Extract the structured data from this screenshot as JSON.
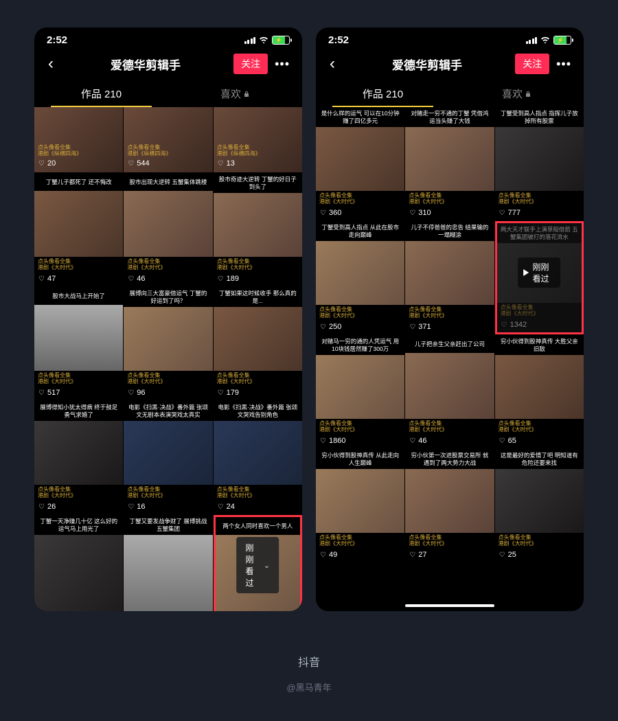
{
  "status": {
    "time": "2:52",
    "battery_icon": "⚡"
  },
  "header": {
    "title": "爱德华剪辑手",
    "follow": "关注"
  },
  "tabs": {
    "works": "作品 210",
    "likes": "喜欢"
  },
  "badges": {
    "float": "刚刚看过",
    "inline": "刚刚看过"
  },
  "left": {
    "row1": [
      {
        "c1": "点头像看全集",
        "c2": "港剧《纵横四海》",
        "likes": "20"
      },
      {
        "c1": "点头像看全集",
        "c2": "港剧《纵横四海》",
        "likes": "544"
      },
      {
        "c1": "点头像看全集",
        "c2": "港剧《纵横四海》",
        "likes": "13"
      }
    ],
    "rows": [
      [
        {
          "t": "丁蟹儿子都死了\n还不悔改",
          "c1": "点头像看全集",
          "c2": "港剧《大时代》",
          "likes": "47"
        },
        {
          "t": "股市出现大逆转\n五蟹集体跳楼",
          "c1": "点头像看全集",
          "c2": "港剧《大时代》",
          "likes": "46"
        },
        {
          "t": "股市奇迹大逆转\n丁蟹的好日子到头了",
          "c1": "点头像看全集",
          "c2": "港剧《大时代》",
          "likes": "189"
        }
      ],
      [
        {
          "t": "股市大战马上开始了",
          "c1": "点头像看全集",
          "c2": "港剧《大时代》",
          "likes": "517"
        },
        {
          "t": "展博向三大富豪借运气\n丁蟹的好运到了吗？",
          "c1": "点头像看全集",
          "c2": "港剧《大时代》",
          "likes": "96"
        },
        {
          "t": "丁蟹如果这时候收手\n那么真的是...",
          "c1": "点头像看全集",
          "c2": "港剧《大时代》",
          "likes": "179"
        }
      ],
      [
        {
          "t": "展博得知小犹太得病\n终于鼓足勇气求婚了",
          "c1": "点头像看全集",
          "c2": "港剧《大时代》",
          "likes": "26"
        },
        {
          "t": "电影《扫黑·决战》番外篇\n张颂文无剧本表演哭戏太真实",
          "c1": "点头像看全集",
          "c2": "港剧《大时代》",
          "likes": "16"
        },
        {
          "t": "电影《扫黑·决战》番外篇\n张颂文哭戏告别角色",
          "c1": "点头像看全集",
          "c2": "港剧《大时代》",
          "likes": "24"
        }
      ],
      [
        {
          "t": "丁蟹一天净赚几十亿\n这么好的运气马上用光了",
          "c1": "",
          "c2": "",
          "likes": ""
        },
        {
          "t": "丁蟹又要发战争财了\n展博挑战五蟹集团",
          "c1": "",
          "c2": "",
          "likes": ""
        },
        {
          "t": "两个女人同时喜欢一个男人",
          "c1": "",
          "c2": "",
          "likes": ""
        }
      ]
    ]
  },
  "right": {
    "rows": [
      [
        {
          "t": "是什么样的运气\n可以在10分钟赚了四亿多元",
          "c1": "点头像看全集",
          "c2": "港剧《大时代》",
          "likes": "360"
        },
        {
          "t": "对赌走一穷不通的丁蟹\n凭借鸿运当头赚了大钱",
          "c1": "点头像看全集",
          "c2": "港剧《大时代》",
          "likes": "310"
        },
        {
          "t": "丁蟹受到高人指点\n指挥儿子放掉所有股票",
          "c1": "点头像看全集",
          "c2": "港剧《大时代》",
          "likes": "777"
        }
      ],
      [
        {
          "t": "丁蟹受到高人指点\n从此在股市走向巅峰",
          "c1": "点头像看全集",
          "c2": "港剧《大时代》",
          "likes": "250"
        },
        {
          "t": "儿子不停爸爸的忠告\n结果输的一塌糊涂",
          "c1": "点头像看全集",
          "c2": "港剧《大时代》",
          "likes": "371"
        },
        {
          "t": "两大天才联手上演草船借箭\n五蟹集团被打的落花流水",
          "c1": "点头像看全集",
          "c2": "港剧《大时代》",
          "likes": "1342"
        }
      ],
      [
        {
          "t": "对赌马一穷的通的人凭运气\n用10块钱居然赚了300万",
          "c1": "点头像看全集",
          "c2": "港剧《大时代》",
          "likes": "1860"
        },
        {
          "t": "儿子把亲生父亲赶出了公司",
          "c1": "点头像看全集",
          "c2": "港剧《大时代》",
          "likes": "46"
        },
        {
          "t": "穷小伙得到股神真传\n大胜父亲旧敌",
          "c1": "点头像看全集",
          "c2": "港剧《大时代》",
          "likes": "65"
        }
      ],
      [
        {
          "t": "穷小伙得到股神真传\n从此走向人生巅峰",
          "c1": "点头像看全集",
          "c2": "港剧《大时代》",
          "likes": "49"
        },
        {
          "t": "穷小伙第一次进股票交易所\n就遇到了两大势力大战",
          "c1": "点头像看全集",
          "c2": "港剧《大时代》",
          "likes": "27"
        },
        {
          "t": "这是最好的爱情了吧\n明知道有危险还要来找",
          "c1": "点头像看全集",
          "c2": "港剧《大时代》",
          "likes": "25"
        }
      ]
    ]
  },
  "footer": {
    "app": "抖音",
    "author": "@黑马青年"
  }
}
